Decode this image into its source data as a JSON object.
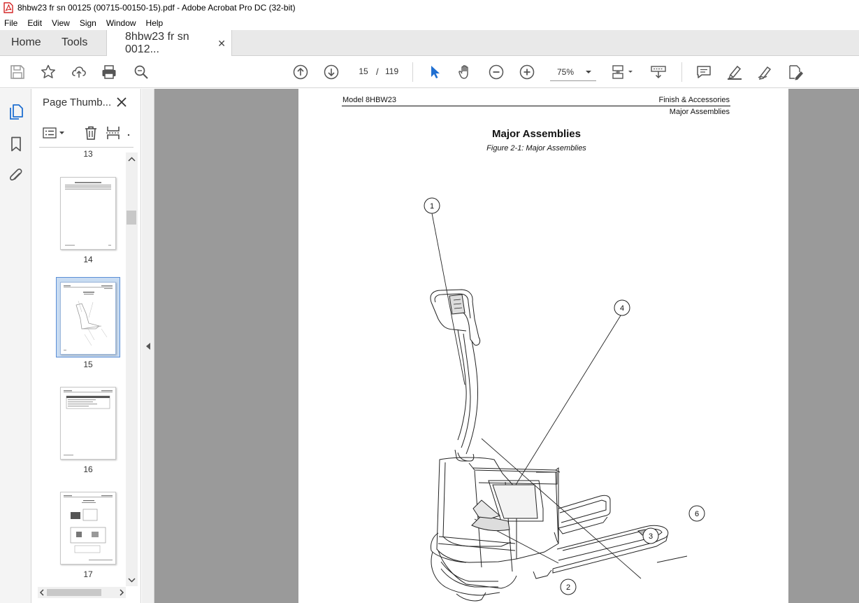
{
  "window": {
    "title": "8hbw23 fr sn 00125 (00715-00150-15).pdf - Adobe Acrobat Pro DC (32-bit)"
  },
  "menu": {
    "items": [
      {
        "label": "File"
      },
      {
        "label": "Edit"
      },
      {
        "label": "View"
      },
      {
        "label": "Sign"
      },
      {
        "label": "Window"
      },
      {
        "label": "Help"
      }
    ]
  },
  "tabs": {
    "home": "Home",
    "tools": "Tools",
    "document": "8hbw23 fr sn 0012...",
    "close_glyph": "✕"
  },
  "toolbar": {
    "current_page": "15",
    "page_separator": "/",
    "total_pages": "119",
    "zoom": "75%",
    "icons": [
      "save-icon",
      "bookmark-star-icon",
      "upload-icon",
      "print-icon",
      "search-icon",
      "page-up-icon",
      "page-down-icon",
      "select-cursor-icon",
      "hand-tool-icon",
      "zoom-out-icon",
      "zoom-in-icon",
      "page-layout-icon",
      "scroll-mode-icon",
      "comment-icon",
      "highlight-icon",
      "draw-icon",
      "fill-sign-icon"
    ]
  },
  "side_panel": {
    "title": "Page Thumb...",
    "close_glyph": "✕",
    "thumbnails": [
      {
        "label": "13"
      },
      {
        "label": "14"
      },
      {
        "label": "15"
      },
      {
        "label": "16"
      },
      {
        "label": "17"
      }
    ],
    "selected_page": "15"
  },
  "document": {
    "header_left": "Model 8HBW23",
    "header_right": "Finish & Accessories",
    "header_sub": "Major Assemblies",
    "heading": "Major Assemblies",
    "caption": "Figure 2-1: Major Assemblies",
    "callouts": [
      "1",
      "4",
      "2",
      "3",
      "6"
    ]
  },
  "colors": {
    "accent_blue": "#1f6fd1",
    "selected_thumb_bg": "#c9dcf2",
    "doc_background": "#9a9a9a"
  }
}
